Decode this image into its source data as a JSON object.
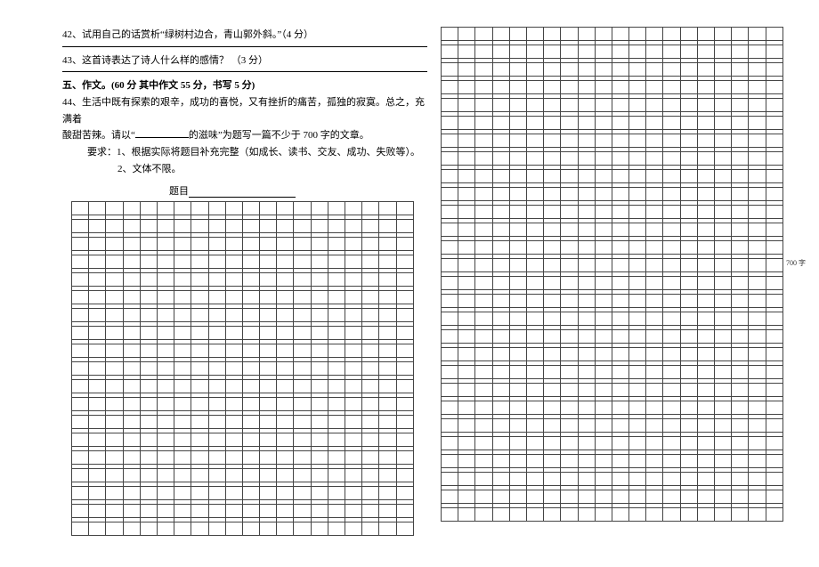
{
  "q42": {
    "prefix": "42、",
    "text": "试用自己的话赏析“绿树村边合，青山郭外斜。”（4 分）"
  },
  "q43": {
    "prefix": "43、",
    "text": "这首诗表达了诗人什么样的感情？ （3 分）"
  },
  "section5": {
    "heading": "五、作文。(60 分  其中作文 55 分，书写 5 分)"
  },
  "q44": {
    "prefix": "44、",
    "line1a": "生活中既有探索的艰辛，成功的喜悦，又有挫折的痛苦，孤独的寂寞。总之，充满着",
    "line2a": "酸甜苦辣。请以“",
    "line2b": "的滋味”为题写一篇不少于 700 字的文章。",
    "req_label": "要求：",
    "req1": "1、根据实际将题目补充完整（如成长、读书、交友、成功、失败等）。",
    "req2": "2、文体不限。",
    "title_label": "题目"
  },
  "marker": "700 字",
  "grid": {
    "cols": 20,
    "left_rows": 19,
    "right_rows": 28
  }
}
